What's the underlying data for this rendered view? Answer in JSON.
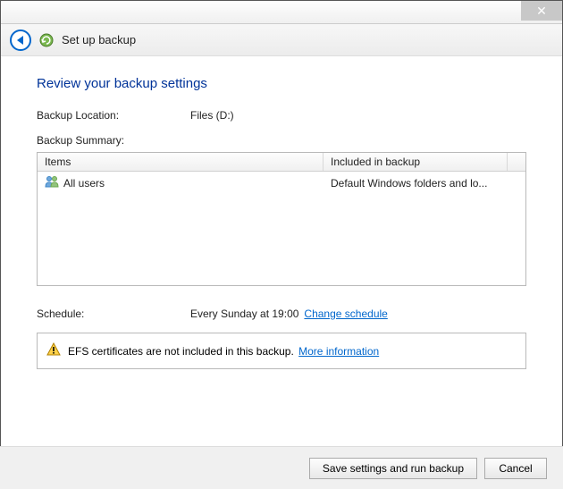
{
  "window": {
    "title": "Set up backup",
    "close_tooltip": "Close"
  },
  "heading": "Review your backup settings",
  "location": {
    "label": "Backup Location:",
    "value": "Files (D:)"
  },
  "summary_label": "Backup Summary:",
  "table": {
    "col_items": "Items",
    "col_included": "Included in backup",
    "rows": [
      {
        "item": "All users",
        "included": "Default Windows folders and lo..."
      }
    ]
  },
  "schedule": {
    "label": "Schedule:",
    "value": "Every Sunday at 19:00",
    "change_link": "Change schedule"
  },
  "warning": {
    "text": "EFS certificates are not included in this backup.",
    "more_link": "More information"
  },
  "buttons": {
    "primary": "Save settings and run backup",
    "cancel": "Cancel"
  }
}
